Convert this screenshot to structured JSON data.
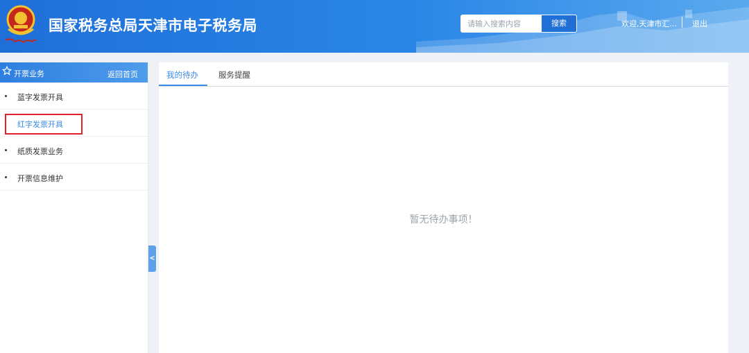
{
  "header": {
    "title": "国家税务总局天津市电子税务局",
    "search_placeholder": "请输入搜索内容",
    "search_button": "搜索",
    "welcome": "欢迎,天津市汇...",
    "logout": "退出"
  },
  "sidebar": {
    "title": "开票业务",
    "home_link": "返回首页",
    "items": [
      {
        "label": "蓝字发票开具"
      },
      {
        "label": "红字发票开具"
      },
      {
        "label": "纸质发票业务"
      },
      {
        "label": "开票信息维护"
      }
    ],
    "collapse_glyph": "<"
  },
  "main": {
    "tabs": [
      {
        "label": "我的待办"
      },
      {
        "label": "服务提醒"
      }
    ],
    "empty_text": "暂无待办事项！"
  },
  "colors": {
    "accent": "#3b8be6",
    "header_blue": "#1e6fd8",
    "highlight_red": "#e0202a"
  },
  "icons": {
    "emblem": "tax-emblem-icon",
    "star": "star-icon",
    "collapse": "chevron-left-icon"
  }
}
